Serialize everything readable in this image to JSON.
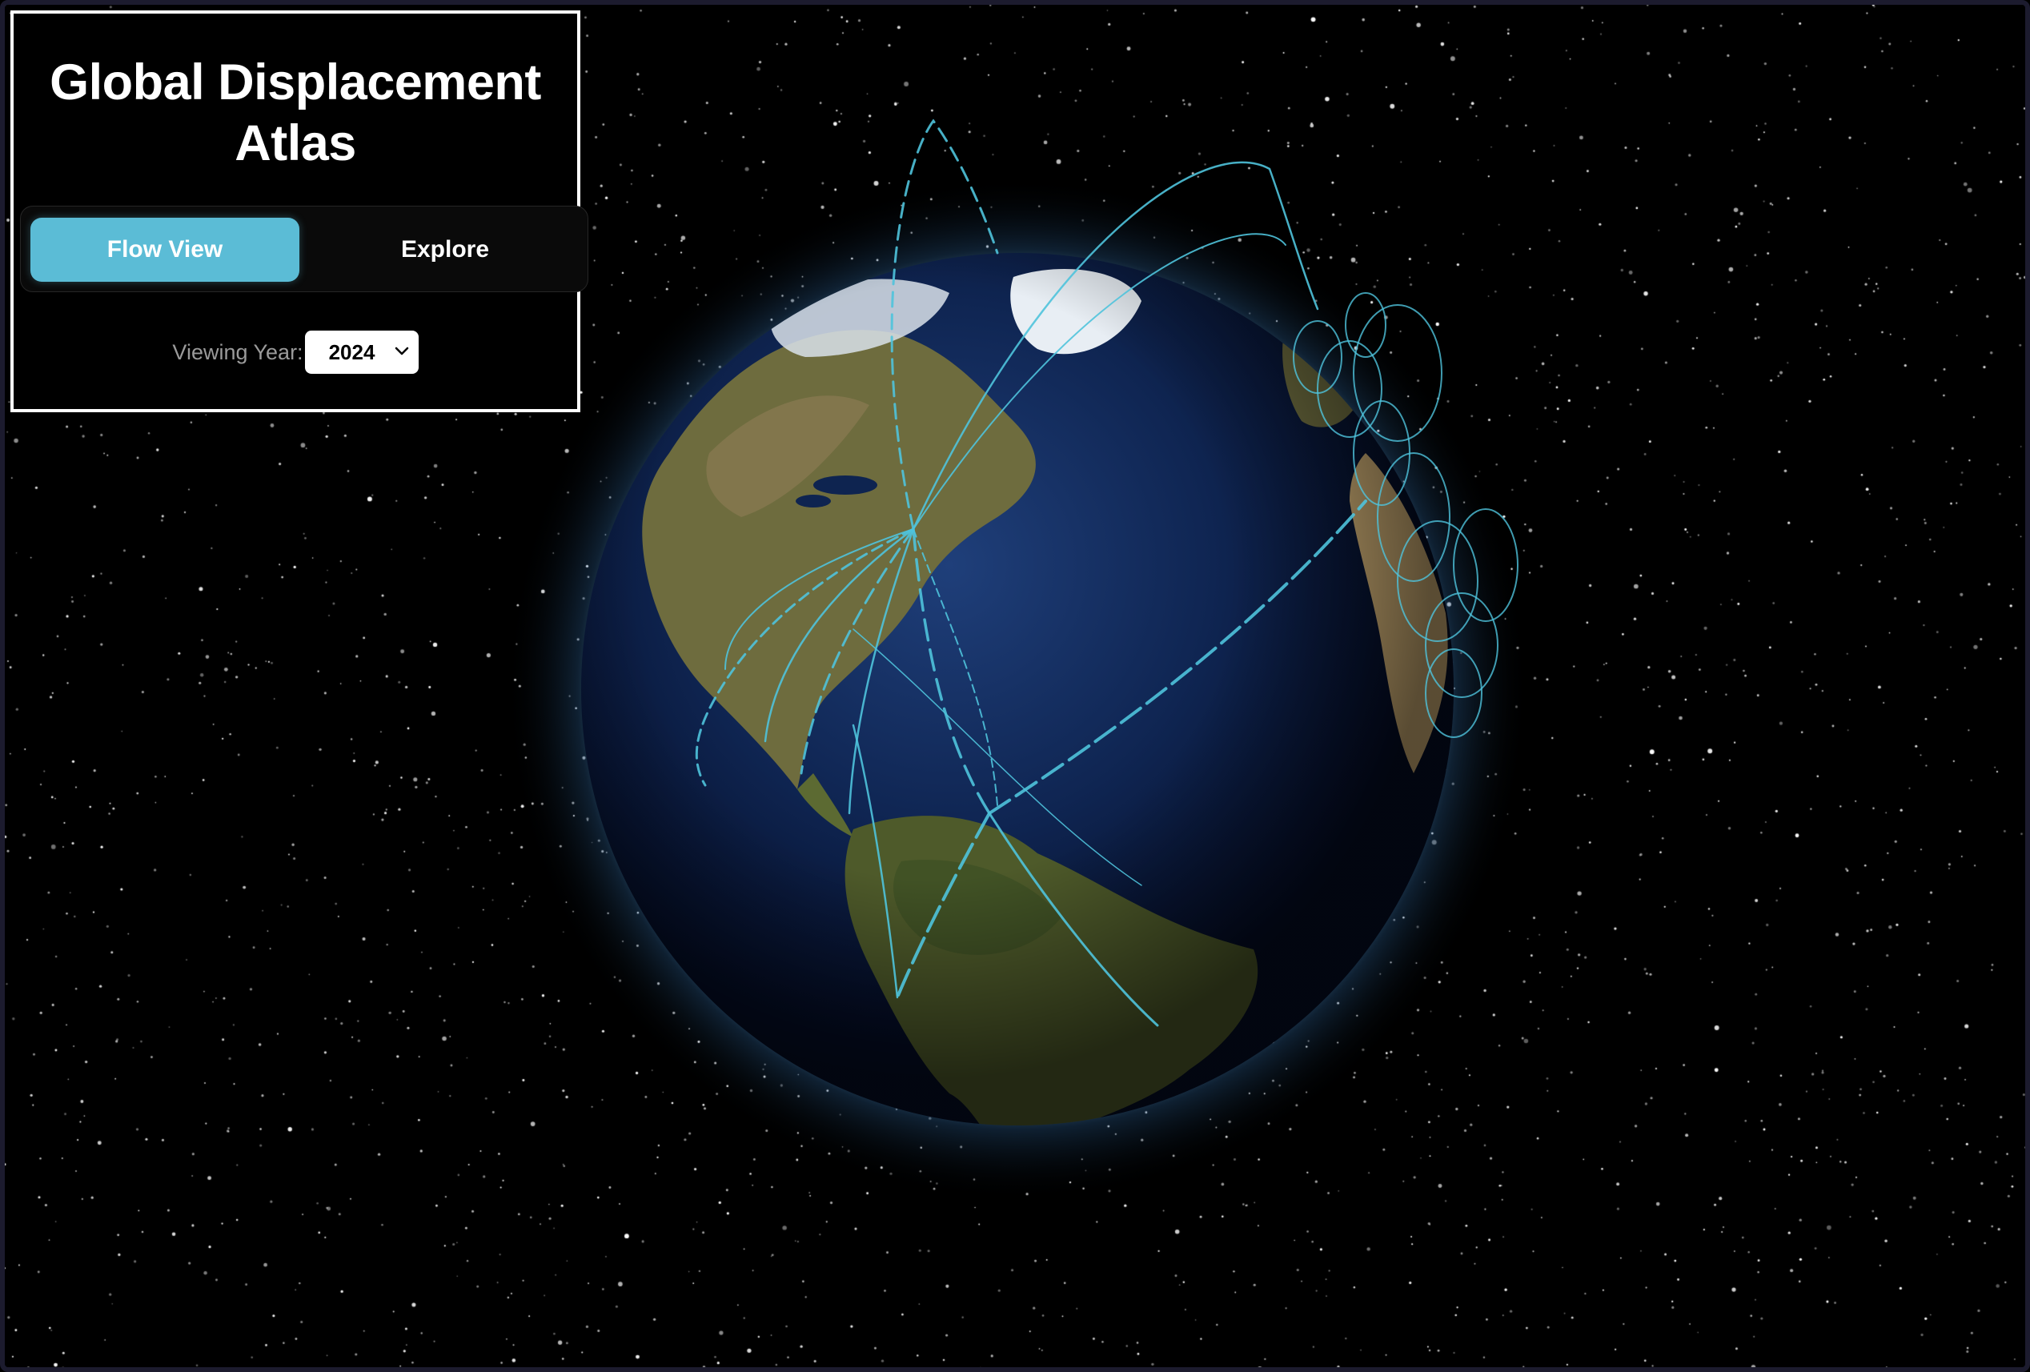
{
  "app": {
    "title": "Global Displacement Atlas"
  },
  "tabs": [
    {
      "label": "Flow View",
      "active": true
    },
    {
      "label": "Explore",
      "active": false
    }
  ],
  "year_filter": {
    "label": "Viewing Year:",
    "selected": "2024",
    "icon": "chevron-down-icon"
  },
  "globe": {
    "flow_color": "#4fc3dc",
    "ocean_color": "#0b1f4a",
    "land_color": "#6b6e3c",
    "atmosphere_color": "#7ec8ff"
  },
  "colors": {
    "accent": "#5bbcd6",
    "panel_border": "#ffffff",
    "background": "#000000"
  }
}
